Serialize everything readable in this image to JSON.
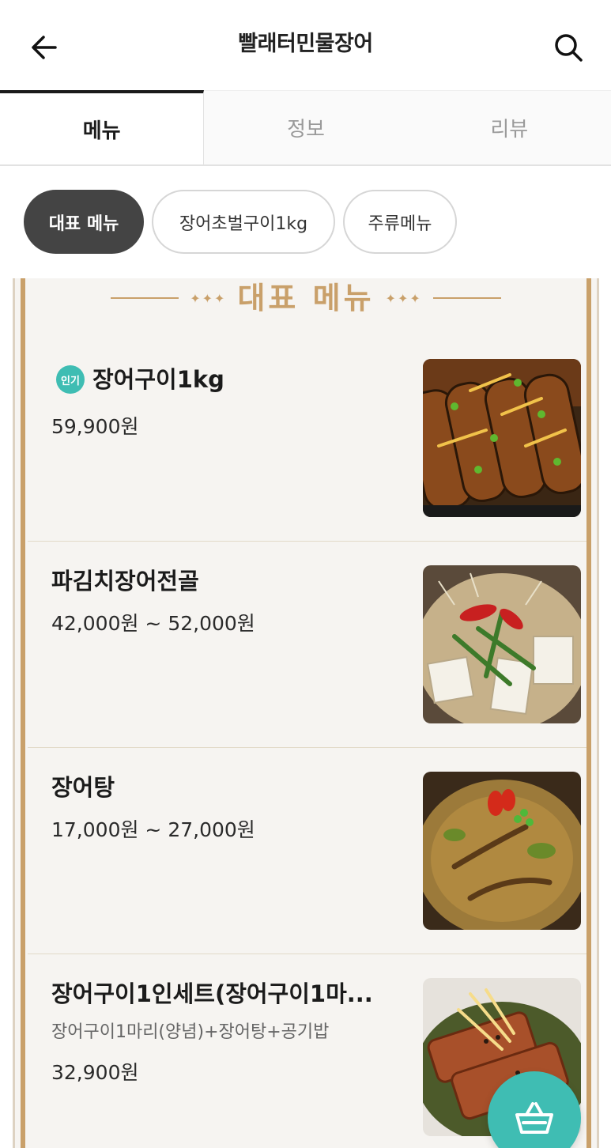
{
  "header": {
    "title": "빨래터민물장어",
    "back_icon": "arrow-left-icon",
    "search_icon": "search-icon"
  },
  "tabs": [
    {
      "label": "메뉴",
      "active": true
    },
    {
      "label": "정보",
      "active": false
    },
    {
      "label": "리뷰",
      "active": false
    }
  ],
  "chips": [
    {
      "label": "대표 메뉴",
      "active": true
    },
    {
      "label": "장어초벌구이1kg",
      "active": false
    },
    {
      "label": "주류메뉴",
      "active": false
    }
  ],
  "section": {
    "title": "대표 메뉴",
    "ornament": "✦✦✦"
  },
  "items": [
    {
      "badge": "인기",
      "name": "장어구이1kg",
      "price": "59,900원"
    },
    {
      "name": "파김치장어전골",
      "price": "42,000원 ~ 52,000원"
    },
    {
      "name": "장어탕",
      "price": "17,000원 ~ 27,000원"
    },
    {
      "name": "장어구이1인세트(장어구이1마...",
      "description": "장어구이1마리(양념)+장어탕+공기밥",
      "price": "32,900원"
    }
  ],
  "cart": {
    "icon": "basket-icon"
  },
  "colors": {
    "accent": "#3fbdb3",
    "gold": "#c9a06a",
    "chip_active": "#444444"
  }
}
